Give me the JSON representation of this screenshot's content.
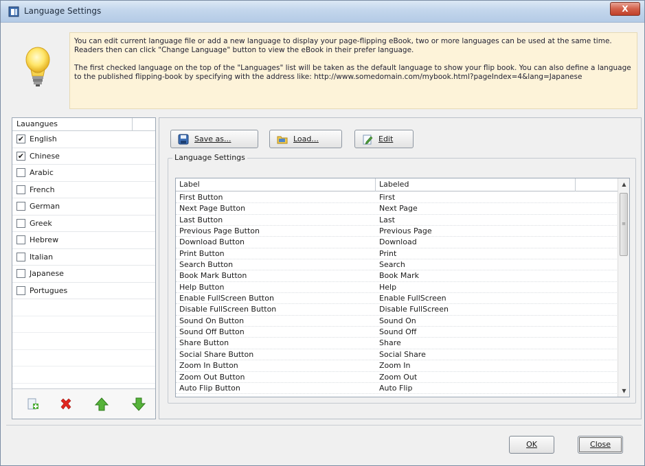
{
  "window": {
    "title": "Language Settings",
    "close_label": "X"
  },
  "info": {
    "paragraph1": "You can edit current language file or add a new language to display your page-flipping eBook, two or more languages can be used at the same time. Readers then can click \"Change Language\" button to view the eBook in their prefer language.",
    "paragraph2": "The first checked language on the top of the \"Languages\" list will be taken as the default language to show your flip book. You can also define a language to the published flipping-book by specifying with the address like: http://www.somedomain.com/mybook.html?pageIndex=4&lang=Japanese"
  },
  "languages": {
    "header": "Lauangues",
    "items": [
      {
        "label": "English",
        "checked": true
      },
      {
        "label": "Chinese",
        "checked": true
      },
      {
        "label": "Arabic",
        "checked": false
      },
      {
        "label": "French",
        "checked": false
      },
      {
        "label": "German",
        "checked": false
      },
      {
        "label": "Greek",
        "checked": false
      },
      {
        "label": "Hebrew",
        "checked": false
      },
      {
        "label": "Italian",
        "checked": false
      },
      {
        "label": "Japanese",
        "checked": false
      },
      {
        "label": "Portugues",
        "checked": false
      }
    ]
  },
  "toolbar": {
    "save_label": "Save as...",
    "load_label": "Load...",
    "edit_label": "Edit"
  },
  "settings_group": {
    "title": "Language Settings",
    "columns": [
      "Label",
      "Labeled"
    ],
    "rows": [
      [
        "First Button",
        "First"
      ],
      [
        "Next Page Button",
        "Next Page"
      ],
      [
        "Last Button",
        "Last"
      ],
      [
        "Previous Page Button",
        "Previous Page"
      ],
      [
        "Download Button",
        "Download"
      ],
      [
        "Print Button",
        "Print"
      ],
      [
        "Search Button",
        "Search"
      ],
      [
        "Book Mark Button",
        "Book Mark"
      ],
      [
        "Help Button",
        "Help"
      ],
      [
        "Enable FullScreen Button",
        "Enable FullScreen"
      ],
      [
        "Disable FullScreen Button",
        "Disable FullScreen"
      ],
      [
        "Sound On Button",
        "Sound On"
      ],
      [
        "Sound Off Button",
        "Sound Off"
      ],
      [
        "Share Button",
        "Share"
      ],
      [
        "Social Share Button",
        "Social Share"
      ],
      [
        "Zoom In Button",
        "Zoom In"
      ],
      [
        "Zoom Out Button",
        "Zoom Out"
      ],
      [
        "Auto Flip Button",
        "Auto Flip"
      ]
    ]
  },
  "dialog": {
    "ok_label": "OK",
    "close_label": "Close"
  },
  "colors": {
    "info_background": "#fdf3d9",
    "title_gradient_top": "#dce8f5",
    "close_red": "#c0412a"
  }
}
